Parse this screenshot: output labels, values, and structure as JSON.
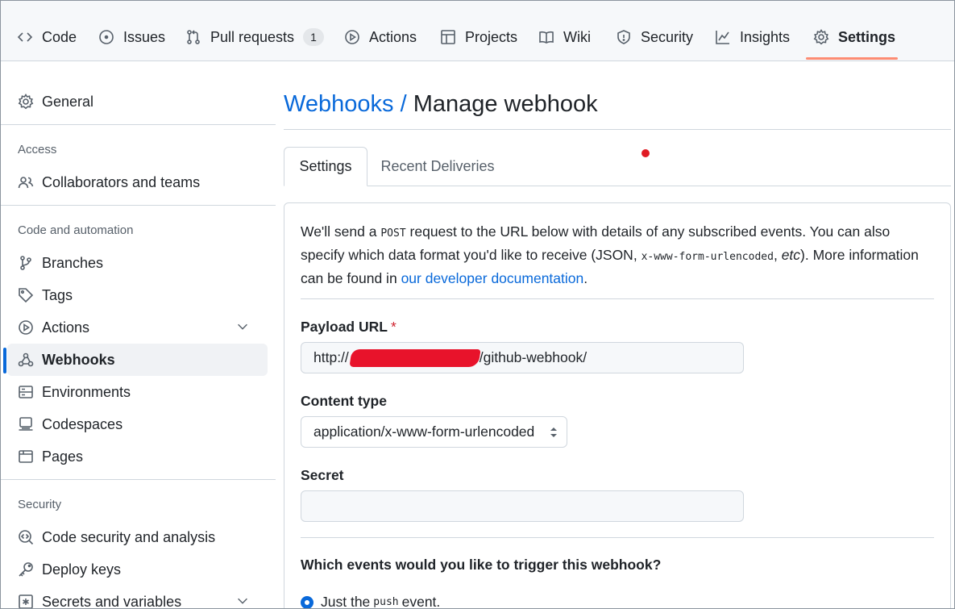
{
  "topnav": {
    "tabs": [
      {
        "label": "Code",
        "icon": "code-icon"
      },
      {
        "label": "Issues",
        "icon": "issue-icon"
      },
      {
        "label": "Pull requests",
        "icon": "pull-request-icon",
        "counter": "1"
      },
      {
        "label": "Actions",
        "icon": "play-icon"
      },
      {
        "label": "Projects",
        "icon": "table-icon"
      },
      {
        "label": "Wiki",
        "icon": "book-icon"
      },
      {
        "label": "Security",
        "icon": "shield-icon"
      },
      {
        "label": "Insights",
        "icon": "graph-icon"
      },
      {
        "label": "Settings",
        "icon": "gear-icon",
        "active": true
      }
    ],
    "active_underline_color": "#fd8c73"
  },
  "sidebar": {
    "general": "General",
    "sections": [
      {
        "heading": "Access",
        "items": [
          "Collaborators and teams"
        ]
      },
      {
        "heading": "Code and automation",
        "items": [
          "Branches",
          "Tags",
          "Actions",
          "Webhooks",
          "Environments",
          "Codespaces",
          "Pages"
        ]
      },
      {
        "heading": "Security",
        "items": [
          "Code security and analysis",
          "Deploy keys",
          "Secrets and variables"
        ]
      }
    ],
    "active_item": "Webhooks"
  },
  "main": {
    "breadcrumb_link": "Webhooks",
    "breadcrumb_sep": "/",
    "title": "Manage webhook",
    "tabs": [
      "Settings",
      "Recent Deliveries"
    ],
    "active_tab": "Settings",
    "intro": {
      "part1": "We'll send a",
      "code1": "POST",
      "part2": "request to the URL below with details of any subscribed events. You can also specify which data format you'd like to receive (JSON,",
      "code2": "x-www-form-urlencoded",
      "part3": ",",
      "etc": "etc",
      "part4": "). More information can be found in",
      "link": "our developer documentation",
      "part5": "."
    },
    "payload_url": {
      "label": "Payload URL",
      "required_mark": "*",
      "value_prefix": "http://",
      "value_suffix": "/github-webhook/"
    },
    "content_type": {
      "label": "Content type",
      "selected": "application/x-www-form-urlencoded"
    },
    "secret": {
      "label": "Secret",
      "value": ""
    },
    "events": {
      "question": "Which events would you like to trigger this webhook?",
      "option_prefix": "Just the",
      "option_code": "push",
      "option_suffix": "event."
    },
    "accent_color": "#0969da"
  }
}
